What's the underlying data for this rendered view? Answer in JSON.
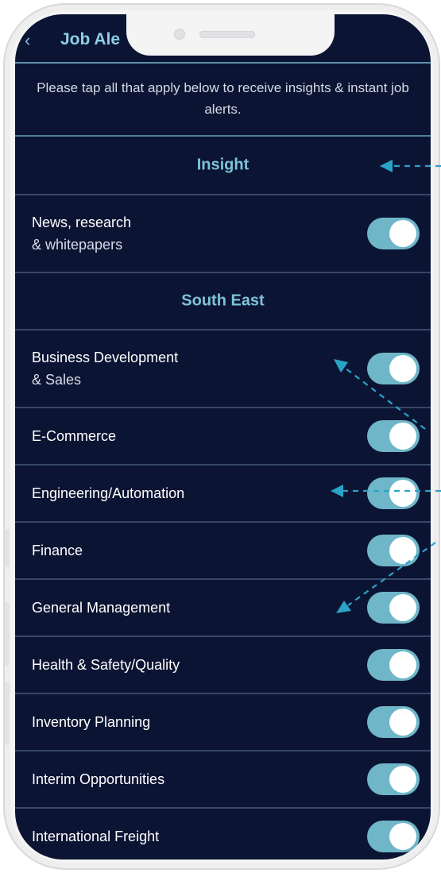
{
  "header": {
    "title": "Job Ale"
  },
  "intro_text": "Please tap all that apply below to receive insights & instant job alerts.",
  "sections": [
    {
      "title": "Insight",
      "items": [
        {
          "line1": "News, research",
          "line2": "& whitepapers",
          "on": true
        }
      ]
    },
    {
      "title": "South East",
      "items": [
        {
          "line1": "Business Development",
          "line2": "& Sales",
          "on": true
        },
        {
          "line1": "E-Commerce",
          "on": true
        },
        {
          "line1": "Engineering/Automation",
          "on": true
        },
        {
          "line1": "Finance",
          "on": true
        },
        {
          "line1": "General Management",
          "on": true
        },
        {
          "line1": "Health & Safety/Quality",
          "on": true
        },
        {
          "line1": "Inventory Planning",
          "on": true
        },
        {
          "line1": "Interim Opportunities",
          "on": true
        },
        {
          "line1": "International Freight",
          "on": true
        }
      ]
    }
  ],
  "colors": {
    "background": "#0c1433",
    "accent": "#7cc3d9",
    "toggle_on": "#6fb6c8",
    "annotation_arrows": "#2aa3c7"
  },
  "icons": {
    "back": "chevron-left-icon"
  }
}
